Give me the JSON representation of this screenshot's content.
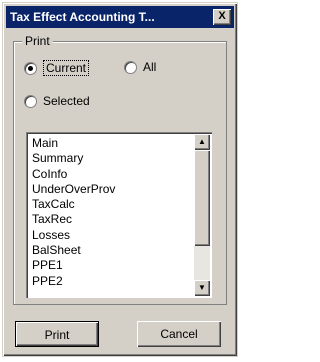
{
  "window": {
    "title": "Tax Effect Accounting T...",
    "close_glyph": "X"
  },
  "print_group": {
    "label": "Print",
    "options": [
      {
        "label": "Current",
        "checked": true
      },
      {
        "label": "All",
        "checked": false
      },
      {
        "label": "Selected",
        "checked": false
      }
    ]
  },
  "listbox": {
    "items": [
      "Main",
      "Summary",
      "CoInfo",
      "UnderOverProv",
      "TaxCalc",
      "TaxRec",
      "Losses",
      "BalSheet",
      "PPE1",
      "PPE2"
    ],
    "scroll_up_icon": "triangle-up-icon",
    "scroll_down_icon": "triangle-down-icon"
  },
  "buttons": {
    "print_label": "Print",
    "cancel_label": "Cancel"
  }
}
